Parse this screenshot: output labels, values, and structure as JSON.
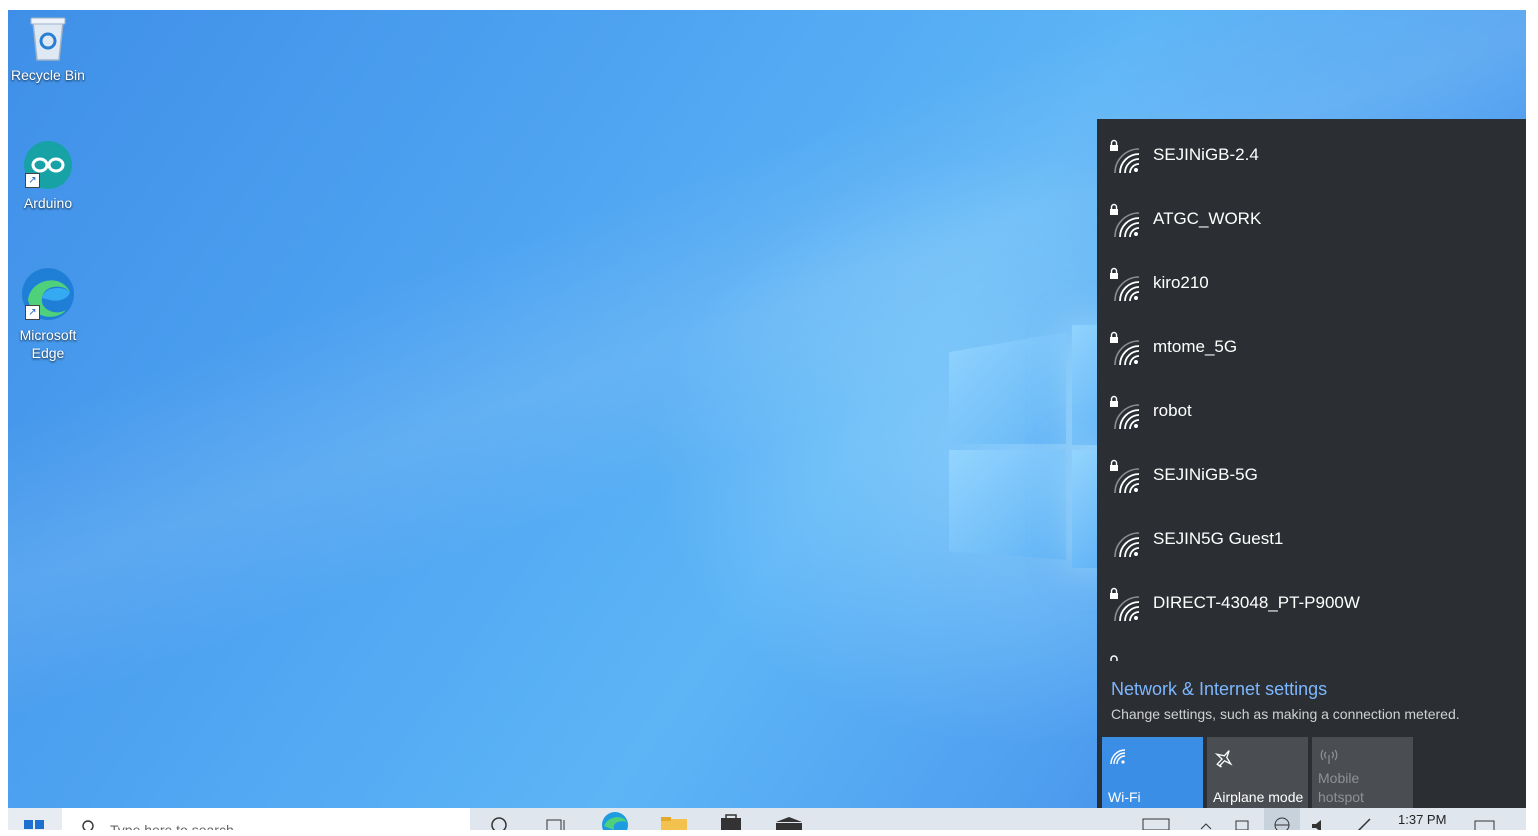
{
  "desktop": {
    "icons": [
      {
        "label": "Recycle Bin"
      },
      {
        "label": "Arduino"
      },
      {
        "label": "Microsoft\nEdge",
        "line1": "Microsoft",
        "line2": "Edge"
      }
    ]
  },
  "network_flyout": {
    "networks": [
      {
        "ssid": "SEJINiGB-2.4",
        "secured": true
      },
      {
        "ssid": "ATGC_WORK",
        "secured": true
      },
      {
        "ssid": "kiro210",
        "secured": true
      },
      {
        "ssid": "mtome_5G",
        "secured": true
      },
      {
        "ssid": "robot",
        "secured": true
      },
      {
        "ssid": "SEJINiGB-5G",
        "secured": true
      },
      {
        "ssid": "SEJIN5G Guest1",
        "secured": false
      },
      {
        "ssid": "DIRECT-43048_PT-P900W",
        "secured": true
      }
    ],
    "settings_link": "Network & Internet settings",
    "settings_description": "Change settings, such as making a connection metered.",
    "quick_actions": {
      "wifi": {
        "label": "Wi-Fi",
        "icon": "wifi-icon",
        "state": "on"
      },
      "airplane": {
        "label": "Airplane mode",
        "icon": "airplane-icon",
        "state": "off"
      },
      "hotspot": {
        "line1": "Mobile",
        "line2": "hotspot",
        "icon": "hotspot-icon",
        "state": "disabled"
      }
    }
  },
  "taskbar": {
    "search_placeholder": "Type here to search",
    "clock": "1:37 PM"
  },
  "colors": {
    "flyout_bg": "#2b2f33",
    "accent": "#3a8ee6",
    "link": "#7db7ff"
  }
}
